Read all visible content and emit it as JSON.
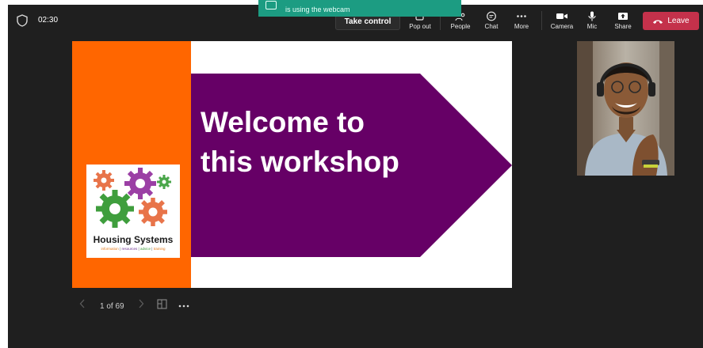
{
  "call": {
    "timer": "02:30"
  },
  "notification": {
    "text": "is using the webcam"
  },
  "toolbar": {
    "take_control": "Take control",
    "popout": "Pop out",
    "people": "People",
    "chat": "Chat",
    "more": "More",
    "camera": "Camera",
    "mic": "Mic",
    "share": "Share",
    "leave": "Leave"
  },
  "slide": {
    "title_line1": "Welcome to",
    "title_line2": "this workshop",
    "logo_title": "Housing Systems",
    "logo_subtitle": [
      "information",
      "resources",
      "advice",
      "training"
    ]
  },
  "slide_nav": {
    "counter": "1 of 69"
  },
  "colors": {
    "background": "#1f1f1f",
    "leave": "#c4314b",
    "slide_orange": "#ff6600",
    "slide_purple": "#660066",
    "notification": "#1c9c82"
  },
  "icons": [
    "shield-icon",
    "popout-icon",
    "people-icon",
    "chat-icon",
    "more-icon",
    "camera-icon",
    "mic-icon",
    "share-icon",
    "phone-hangup-icon",
    "chevron-left-icon",
    "chevron-right-icon",
    "grid-view-icon",
    "ellipsis-icon"
  ]
}
